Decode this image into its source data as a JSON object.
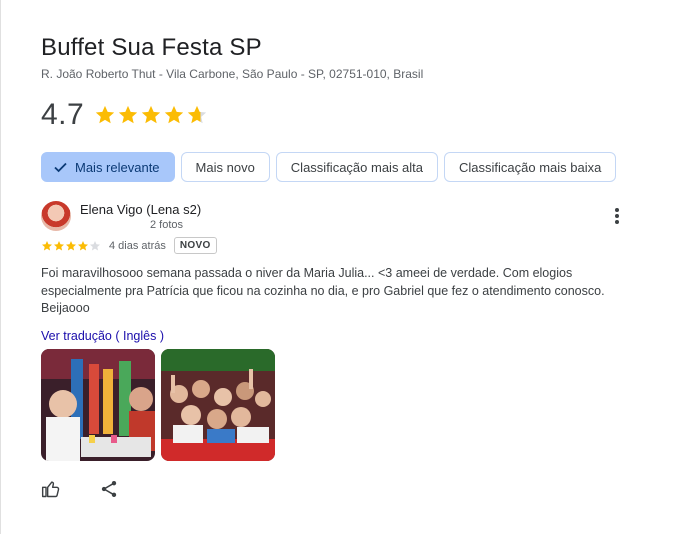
{
  "place": {
    "name": "Buffet Sua Festa SP",
    "address": "R. João Roberto Thut - Vila Carbone, São Paulo - SP, 02751-010, Brasil",
    "rating": "4.7",
    "rating_value": 4.7
  },
  "sort_chips": [
    {
      "label": "Mais relevante",
      "selected": true
    },
    {
      "label": "Mais novo",
      "selected": false
    },
    {
      "label": "Classificação mais alta",
      "selected": false
    },
    {
      "label": "Classificação mais baixa",
      "selected": false
    }
  ],
  "review": {
    "author": "Elena Vigo (Lena s2)",
    "photo_count": "2 fotos",
    "stars": 4,
    "date": "4 dias atrás",
    "badge": "NOVO",
    "text_lines": [
      "Foi maravilhosooo semana passada o niver da Maria Julia... <3 ameei de verdade. Com elogios",
      "especialmente pra Patrícia que ficou na cozinha no dia, e pro Gabriel que fez o atendimento conosco.",
      "Beijaooo"
    ],
    "translate_link": "Ver tradução ( Inglês )"
  },
  "icons": {
    "selected_check": "check-icon",
    "more": "more-vert-icon",
    "like": "thumb-up-icon",
    "share": "share-icon"
  },
  "colors": {
    "star": "#fbbc04",
    "star_empty": "#dadce0",
    "chip_selected_bg": "#a8c7fa",
    "link": "#1a0dab"
  }
}
